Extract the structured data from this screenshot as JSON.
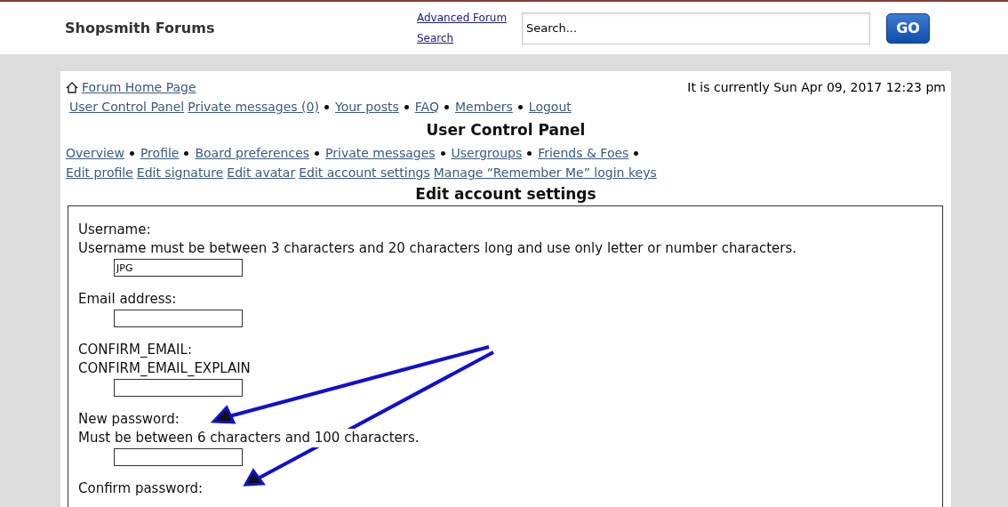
{
  "header": {
    "site_title": "Shopsmith Forums",
    "advanced_search_link": "Advanced Forum Search",
    "search": {
      "value": "Search..."
    },
    "go_button": "GO"
  },
  "panel": {
    "home_link": "Forum Home Page",
    "current_time": "It is currently Sun Apr 09, 2017 12:23 pm",
    "nav_links": [
      {
        "label": "User Control Panel",
        "bullet_before": false
      },
      {
        "label": "Private messages (0)",
        "bullet_before": false
      },
      {
        "label": "Your posts",
        "bullet_before": true
      },
      {
        "label": "FAQ",
        "bullet_before": true
      },
      {
        "label": "Members",
        "bullet_before": true
      },
      {
        "label": "Logout",
        "bullet_before": true
      }
    ],
    "page_title": "User Control Panel",
    "tabs": [
      {
        "label": "Overview",
        "bullet_after": true
      },
      {
        "label": "Profile",
        "bullet_after": true
      },
      {
        "label": "Board preferences",
        "bullet_after": true
      },
      {
        "label": "Private messages",
        "bullet_after": true
      },
      {
        "label": "Usergroups",
        "bullet_after": true
      },
      {
        "label": "Friends & Foes",
        "bullet_after": true
      }
    ],
    "sub_links": [
      "Edit profile",
      "Edit signature",
      "Edit avatar",
      "Edit account settings",
      "Manage “Remember Me” login keys"
    ],
    "section_title": "Edit account settings",
    "fields": [
      {
        "label": "Username:",
        "explain": "Username must be between 3 characters and 20 characters long and use only letter or number characters.",
        "value": "JPG",
        "kind": "text_field"
      },
      {
        "label": "Email address:",
        "kind": "text_field"
      },
      {
        "label": "CONFIRM_EMAIL:",
        "explain": "CONFIRM_EMAIL_EXPLAIN",
        "kind": "text_field"
      },
      {
        "label": "New password:",
        "explain": "Must be between 6 characters and 100 characters.",
        "kind": "text_field"
      },
      {
        "label": "Confirm password:",
        "kind": "label_only"
      }
    ]
  }
}
